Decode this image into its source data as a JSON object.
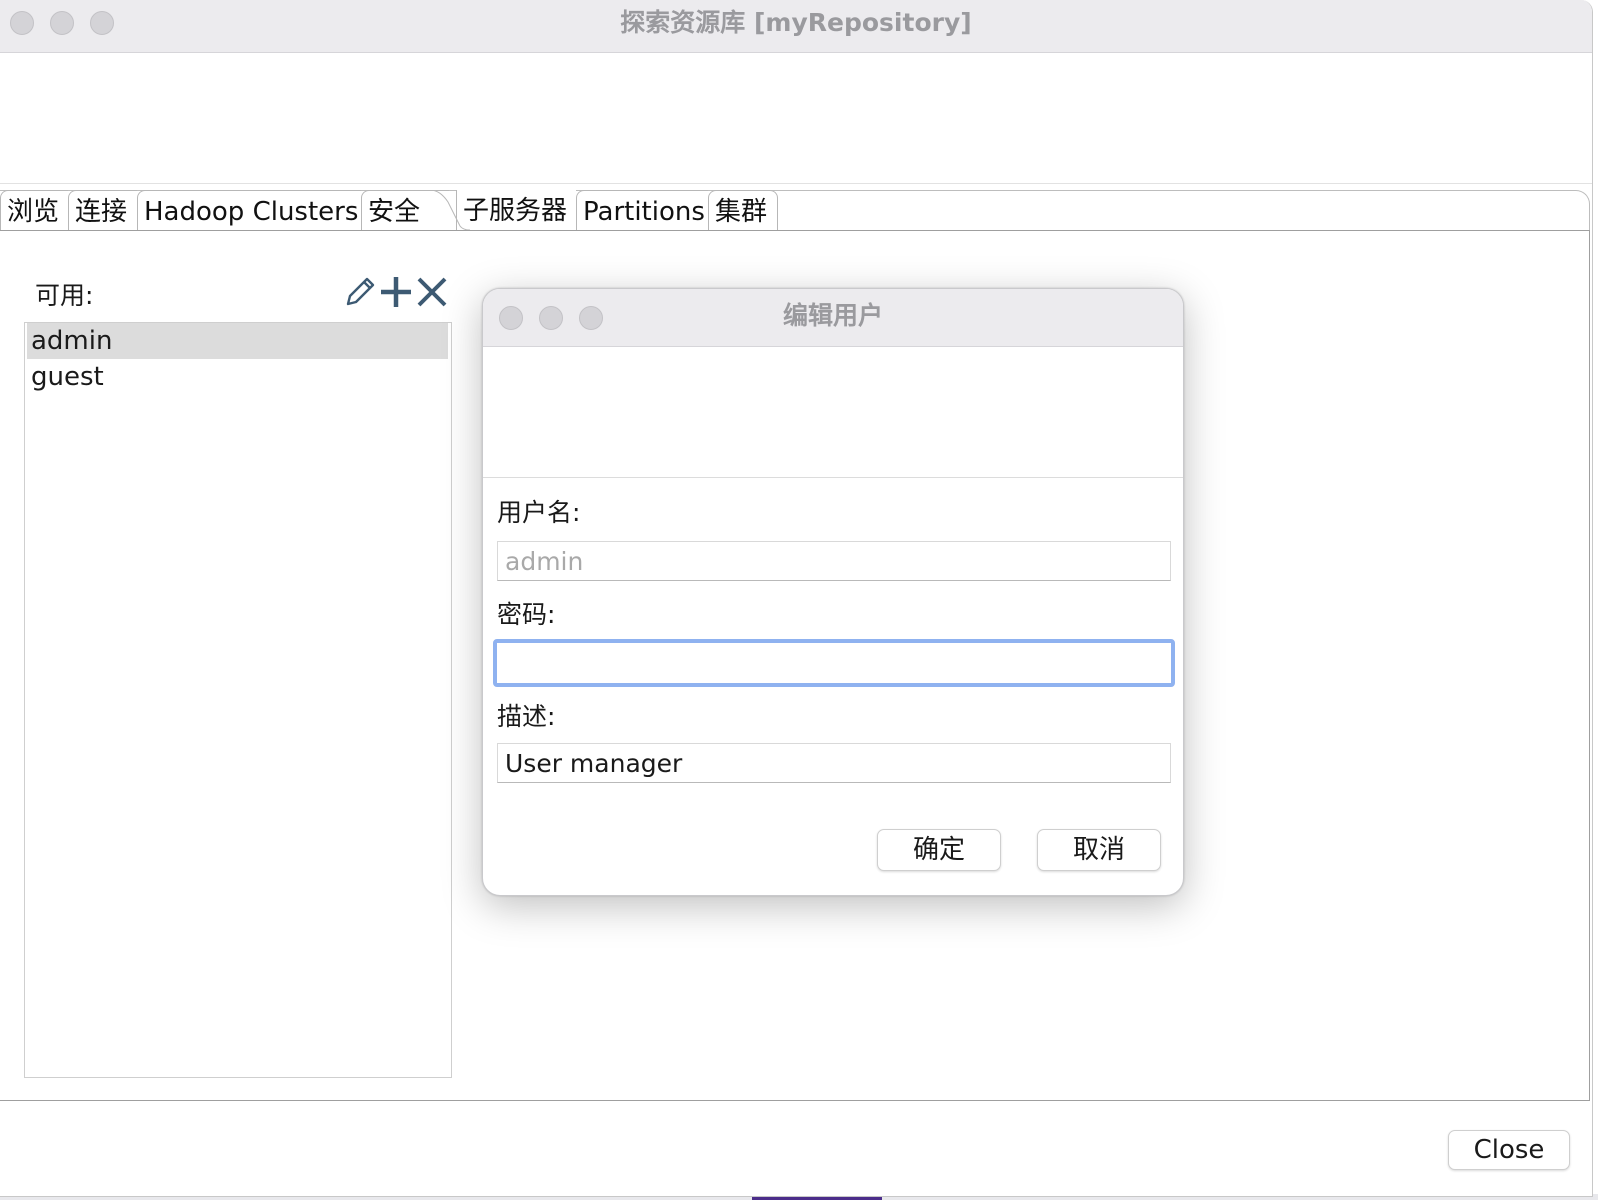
{
  "window": {
    "title": "探索资源库 [myRepository]"
  },
  "tabs": [
    {
      "label": "浏览"
    },
    {
      "label": "连接"
    },
    {
      "label": "Hadoop Clusters"
    },
    {
      "label": "安全"
    },
    {
      "label": "子服务器"
    },
    {
      "label": "Partitions"
    },
    {
      "label": "集群"
    }
  ],
  "active_tab": "安全",
  "security": {
    "available_label": "可用:",
    "users": [
      {
        "name": "admin",
        "selected": true
      },
      {
        "name": "guest",
        "selected": false
      }
    ],
    "icons": [
      "edit-icon",
      "add-icon",
      "delete-icon"
    ]
  },
  "footer": {
    "close_label": "Close"
  },
  "dialog": {
    "title": "编辑用户",
    "username_label": "用户名:",
    "username_value": "admin",
    "password_label": "密码:",
    "password_value": "",
    "description_label": "描述:",
    "description_value": "User manager",
    "ok_label": "确定",
    "cancel_label": "取消"
  },
  "colors": {
    "focus_ring": "#8fb2f0",
    "icon": "#3d5a73",
    "titlebar": "#ecebee"
  }
}
